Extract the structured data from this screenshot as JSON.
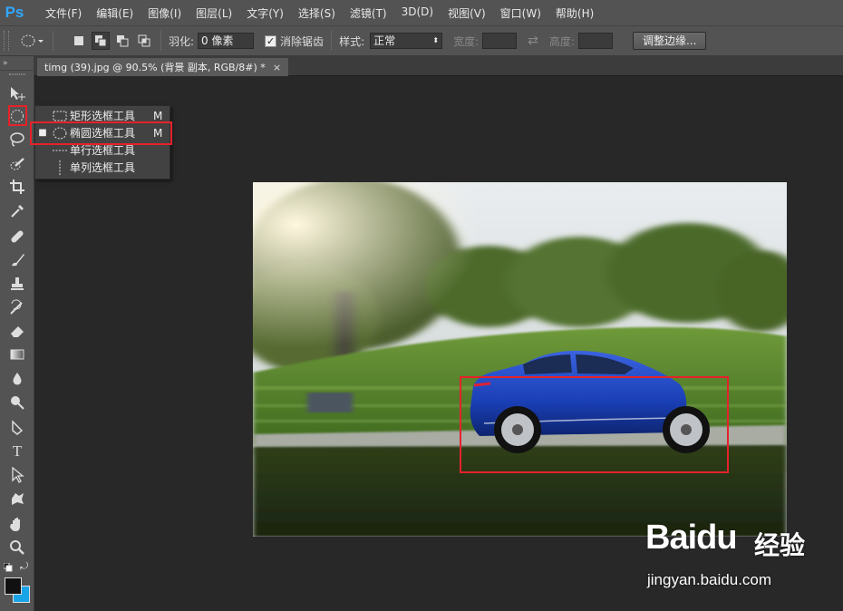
{
  "app": {
    "logo": "Ps"
  },
  "menu": [
    "文件(F)",
    "编辑(E)",
    "图像(I)",
    "图层(L)",
    "文字(Y)",
    "选择(S)",
    "滤镜(T)",
    "3D(D)",
    "视图(V)",
    "窗口(W)",
    "帮助(H)"
  ],
  "options": {
    "feather_label": "羽化:",
    "feather_value": "0 像素",
    "antialias_label": "消除锯齿",
    "antialias_checked": true,
    "style_label": "样式:",
    "style_value": "正常",
    "width_label": "宽度:",
    "height_label": "高度:",
    "refine_edge_button": "调整边缘..."
  },
  "document_tab": {
    "title": "timg (39).jpg @ 90.5% (背景 副本, RGB/8#) *",
    "close": "×"
  },
  "flyout": {
    "items": [
      {
        "name": "矩形选框工具",
        "key": "M",
        "selected": false,
        "icon": "rect-marquee-icon"
      },
      {
        "name": "椭圆选框工具",
        "key": "M",
        "selected": true,
        "icon": "ellipse-marquee-icon"
      },
      {
        "name": "单行选框工具",
        "key": "",
        "selected": false,
        "icon": "single-row-marquee-icon"
      },
      {
        "name": "单列选框工具",
        "key": "",
        "selected": false,
        "icon": "single-column-marquee-icon"
      }
    ]
  },
  "watermark": {
    "logo": "Baidu",
    "cn": "经验",
    "url": "jingyan.baidu.com"
  },
  "colors": {
    "accent_red": "#e5222b",
    "ps_blue": "#31a8ff",
    "car_blue": "#1a3fb5"
  }
}
